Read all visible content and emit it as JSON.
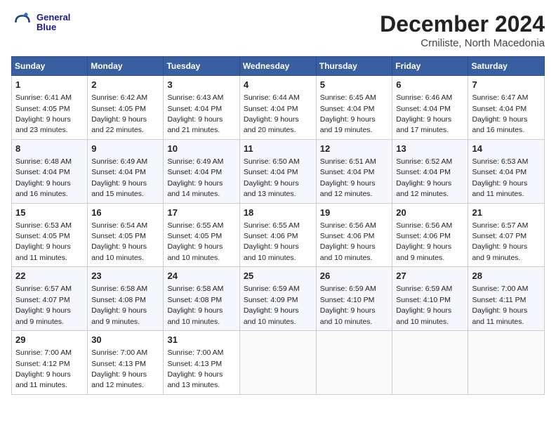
{
  "header": {
    "logo_line1": "General",
    "logo_line2": "Blue",
    "title": "December 2024",
    "subtitle": "Crniliste, North Macedonia"
  },
  "days_of_week": [
    "Sunday",
    "Monday",
    "Tuesday",
    "Wednesday",
    "Thursday",
    "Friday",
    "Saturday"
  ],
  "weeks": [
    [
      {
        "day": "1",
        "sunrise": "6:41 AM",
        "sunset": "4:05 PM",
        "daylight": "9 hours and 23 minutes."
      },
      {
        "day": "2",
        "sunrise": "6:42 AM",
        "sunset": "4:05 PM",
        "daylight": "9 hours and 22 minutes."
      },
      {
        "day": "3",
        "sunrise": "6:43 AM",
        "sunset": "4:04 PM",
        "daylight": "9 hours and 21 minutes."
      },
      {
        "day": "4",
        "sunrise": "6:44 AM",
        "sunset": "4:04 PM",
        "daylight": "9 hours and 20 minutes."
      },
      {
        "day": "5",
        "sunrise": "6:45 AM",
        "sunset": "4:04 PM",
        "daylight": "9 hours and 19 minutes."
      },
      {
        "day": "6",
        "sunrise": "6:46 AM",
        "sunset": "4:04 PM",
        "daylight": "9 hours and 17 minutes."
      },
      {
        "day": "7",
        "sunrise": "6:47 AM",
        "sunset": "4:04 PM",
        "daylight": "9 hours and 16 minutes."
      }
    ],
    [
      {
        "day": "8",
        "sunrise": "6:48 AM",
        "sunset": "4:04 PM",
        "daylight": "9 hours and 16 minutes."
      },
      {
        "day": "9",
        "sunrise": "6:49 AM",
        "sunset": "4:04 PM",
        "daylight": "9 hours and 15 minutes."
      },
      {
        "day": "10",
        "sunrise": "6:49 AM",
        "sunset": "4:04 PM",
        "daylight": "9 hours and 14 minutes."
      },
      {
        "day": "11",
        "sunrise": "6:50 AM",
        "sunset": "4:04 PM",
        "daylight": "9 hours and 13 minutes."
      },
      {
        "day": "12",
        "sunrise": "6:51 AM",
        "sunset": "4:04 PM",
        "daylight": "9 hours and 12 minutes."
      },
      {
        "day": "13",
        "sunrise": "6:52 AM",
        "sunset": "4:04 PM",
        "daylight": "9 hours and 12 minutes."
      },
      {
        "day": "14",
        "sunrise": "6:53 AM",
        "sunset": "4:04 PM",
        "daylight": "9 hours and 11 minutes."
      }
    ],
    [
      {
        "day": "15",
        "sunrise": "6:53 AM",
        "sunset": "4:05 PM",
        "daylight": "9 hours and 11 minutes."
      },
      {
        "day": "16",
        "sunrise": "6:54 AM",
        "sunset": "4:05 PM",
        "daylight": "9 hours and 10 minutes."
      },
      {
        "day": "17",
        "sunrise": "6:55 AM",
        "sunset": "4:05 PM",
        "daylight": "9 hours and 10 minutes."
      },
      {
        "day": "18",
        "sunrise": "6:55 AM",
        "sunset": "4:06 PM",
        "daylight": "9 hours and 10 minutes."
      },
      {
        "day": "19",
        "sunrise": "6:56 AM",
        "sunset": "4:06 PM",
        "daylight": "9 hours and 10 minutes."
      },
      {
        "day": "20",
        "sunrise": "6:56 AM",
        "sunset": "4:06 PM",
        "daylight": "9 hours and 9 minutes."
      },
      {
        "day": "21",
        "sunrise": "6:57 AM",
        "sunset": "4:07 PM",
        "daylight": "9 hours and 9 minutes."
      }
    ],
    [
      {
        "day": "22",
        "sunrise": "6:57 AM",
        "sunset": "4:07 PM",
        "daylight": "9 hours and 9 minutes."
      },
      {
        "day": "23",
        "sunrise": "6:58 AM",
        "sunset": "4:08 PM",
        "daylight": "9 hours and 9 minutes."
      },
      {
        "day": "24",
        "sunrise": "6:58 AM",
        "sunset": "4:08 PM",
        "daylight": "9 hours and 10 minutes."
      },
      {
        "day": "25",
        "sunrise": "6:59 AM",
        "sunset": "4:09 PM",
        "daylight": "9 hours and 10 minutes."
      },
      {
        "day": "26",
        "sunrise": "6:59 AM",
        "sunset": "4:10 PM",
        "daylight": "9 hours and 10 minutes."
      },
      {
        "day": "27",
        "sunrise": "6:59 AM",
        "sunset": "4:10 PM",
        "daylight": "9 hours and 10 minutes."
      },
      {
        "day": "28",
        "sunrise": "7:00 AM",
        "sunset": "4:11 PM",
        "daylight": "9 hours and 11 minutes."
      }
    ],
    [
      {
        "day": "29",
        "sunrise": "7:00 AM",
        "sunset": "4:12 PM",
        "daylight": "9 hours and 11 minutes."
      },
      {
        "day": "30",
        "sunrise": "7:00 AM",
        "sunset": "4:13 PM",
        "daylight": "9 hours and 12 minutes."
      },
      {
        "day": "31",
        "sunrise": "7:00 AM",
        "sunset": "4:13 PM",
        "daylight": "9 hours and 13 minutes."
      },
      null,
      null,
      null,
      null
    ]
  ]
}
